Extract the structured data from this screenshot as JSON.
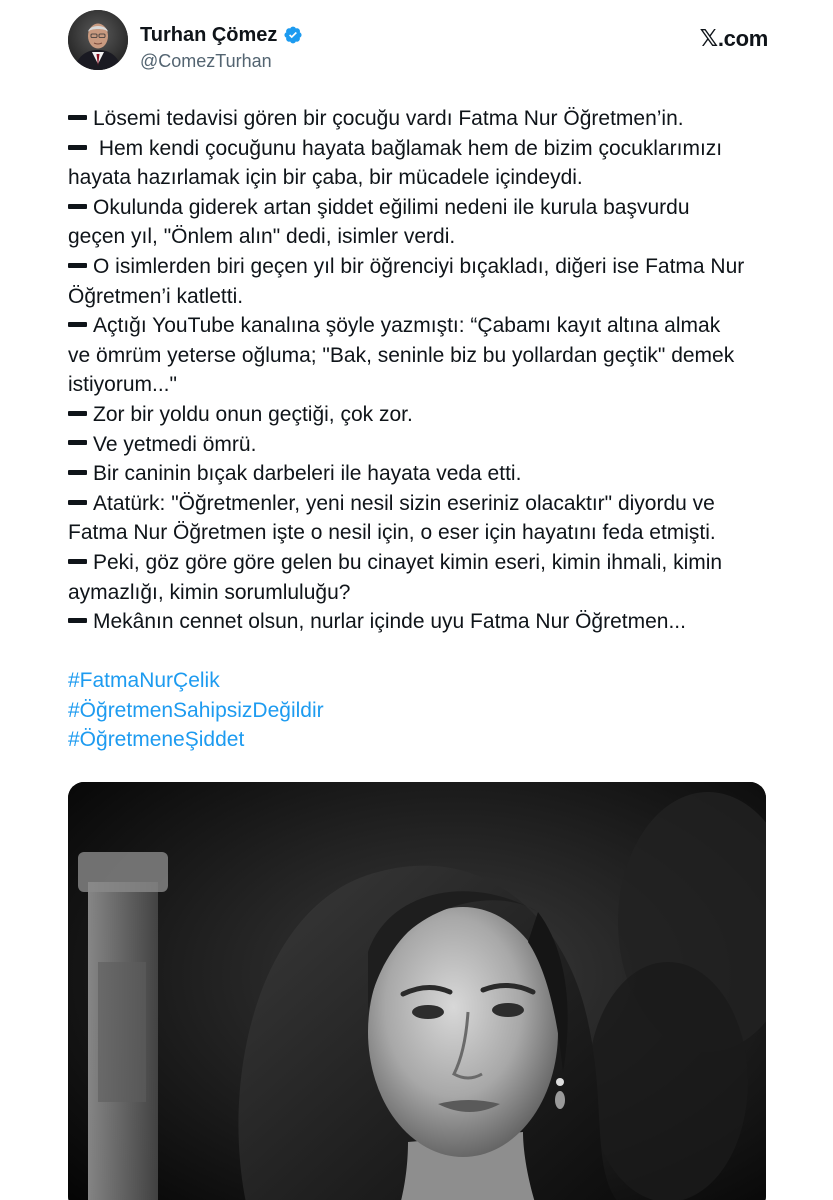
{
  "author": {
    "name": "Turhan Çömez",
    "handle": "@ComezTurhan",
    "verified": true,
    "avatar_icon": "profile-photo"
  },
  "brand": {
    "glyph": "𝕏",
    "suffix": ".com"
  },
  "tweet": {
    "lines": [
      {
        "dash": true,
        "text": "Lösemi tedavisi gören bir çocuğu vardı Fatma Nur Öğretmen’in."
      },
      {
        "dash": true,
        "text": " Hem kendi çocuğunu hayata bağlamak hem de bizim çocuklarımızı"
      },
      {
        "dash": false,
        "text": "hayata hazırlamak için bir çaba, bir mücadele içindeydi."
      },
      {
        "dash": true,
        "text": "Okulunda giderek artan şiddet eğilimi nedeni ile kurula başvurdu"
      },
      {
        "dash": false,
        "text": "geçen yıl, \"Önlem alın\" dedi, isimler verdi."
      },
      {
        "dash": true,
        "text": "O isimlerden biri geçen yıl bir öğrenciyi bıçakladı, diğeri ise Fatma Nur"
      },
      {
        "dash": false,
        "text": "Öğretmen’i katletti."
      },
      {
        "dash": true,
        "text": "Açtığı YouTube kanalına şöyle yazmıştı: “Çabamı kayıt altına almak"
      },
      {
        "dash": false,
        "text": "ve ömrüm yeterse oğluma; \"Bak, seninle biz bu yollardan geçtik\" demek"
      },
      {
        "dash": false,
        "text": "istiyorum...\""
      },
      {
        "dash": true,
        "text": "Zor bir yoldu onun geçtiği, çok zor."
      },
      {
        "dash": true,
        "text": "Ve yetmedi ömrü."
      },
      {
        "dash": true,
        "text": "Bir caninin bıçak darbeleri ile hayata veda etti."
      },
      {
        "dash": true,
        "text": "Atatürk: \"Öğretmenler, yeni nesil sizin eseriniz olacaktır\" diyordu ve"
      },
      {
        "dash": false,
        "text": "Fatma Nur Öğretmen işte o nesil için, o eser için hayatını feda etmişti."
      },
      {
        "dash": true,
        "text": "Peki, göz göre göre gelen bu cinayet kimin eseri, kimin ihmali, kimin"
      },
      {
        "dash": false,
        "text": "aymazlığı, kimin sorumluluğu?"
      },
      {
        "dash": true,
        "text": "Mekânın cennet olsun, nurlar içinde uyu Fatma Nur Öğretmen..."
      }
    ],
    "hashtags": [
      "#FatmaNurÇelik",
      "#ÖğretmenSahipsizDeğildir",
      "#ÖğretmeneŞiddet"
    ]
  },
  "media": {
    "type": "black-and-white portrait photo",
    "icon": "photo"
  },
  "colors": {
    "text": "#0f1419",
    "secondary": "#536471",
    "link": "#1d9bf0",
    "verified": "#1d9bf0"
  }
}
